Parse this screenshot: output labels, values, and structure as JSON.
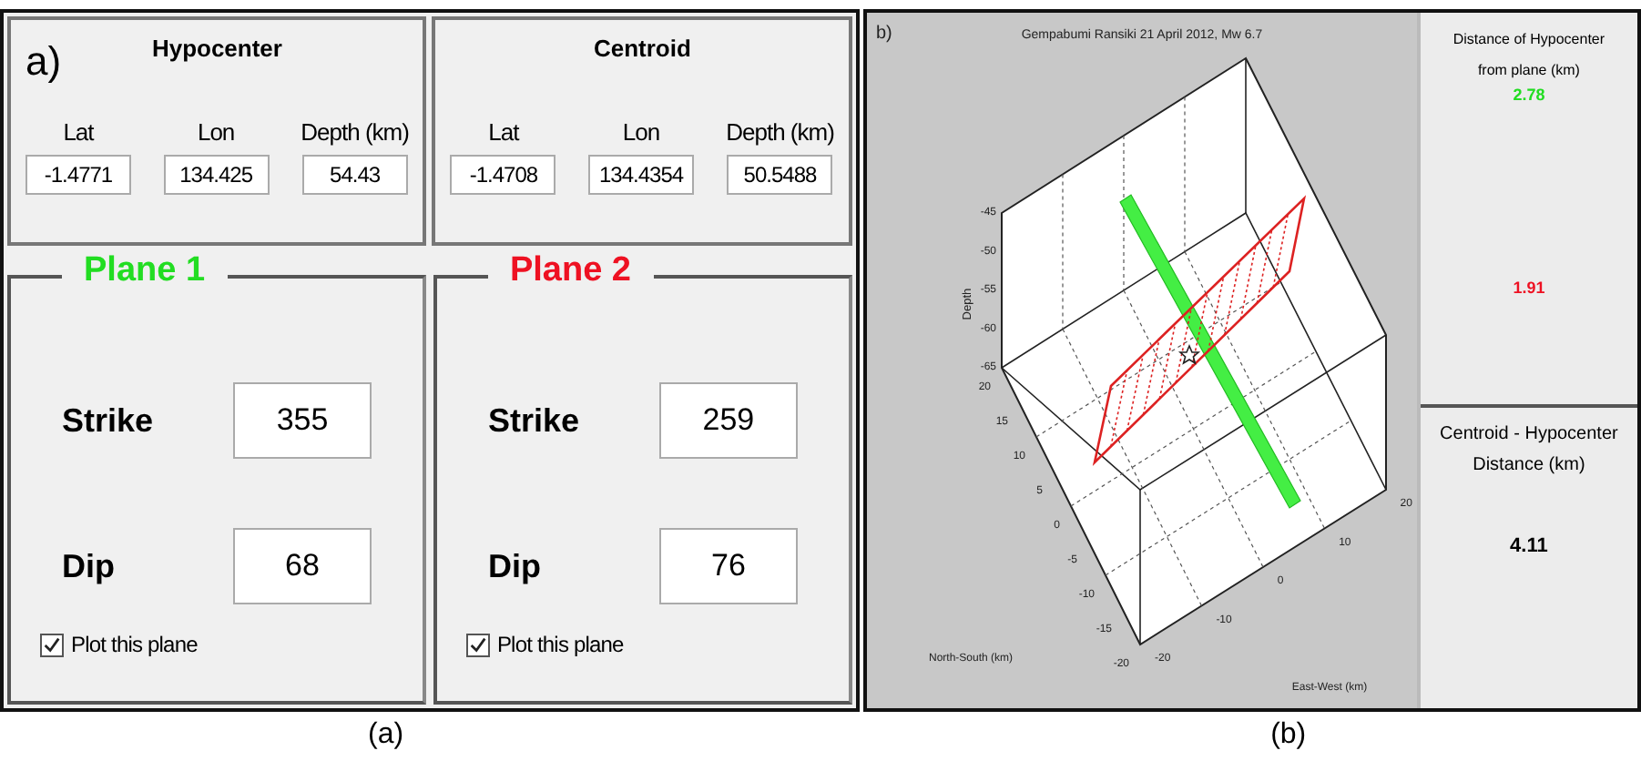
{
  "panel_a": {
    "label": "a)",
    "locations": [
      {
        "title": "Hypocenter",
        "fields": [
          {
            "label": "Lat",
            "value": "-1.4771"
          },
          {
            "label": "Lon",
            "value": "134.425"
          },
          {
            "label": "Depth (km)",
            "value": "54.43"
          }
        ]
      },
      {
        "title": "Centroid",
        "fields": [
          {
            "label": "Lat",
            "value": "-1.4708"
          },
          {
            "label": "Lon",
            "value": "134.4354"
          },
          {
            "label": "Depth (km)",
            "value": "50.5488"
          }
        ]
      }
    ],
    "planes": [
      {
        "title": "Plane 1",
        "color": "#22dd22",
        "strike_label": "Strike",
        "strike": "355",
        "dip_label": "Dip",
        "dip": "68",
        "plot_label": "Plot this plane",
        "checked": true
      },
      {
        "title": "Plane 2",
        "color": "#ee1122",
        "strike_label": "Strike",
        "strike": "259",
        "dip_label": "Dip",
        "dip": "76",
        "plot_label": "Plot this plane",
        "checked": true
      }
    ]
  },
  "panel_b": {
    "label": "b)",
    "plot_title": "Gempabumi Ransiki 21 April 2012, Mw 6.7",
    "depth_label": "Depth",
    "ns_label": "North-South (km)",
    "ew_label": "East-West (km)",
    "depth_ticks": [
      "-45",
      "-50",
      "-55",
      "-60",
      "-65"
    ],
    "ns_ticks": [
      "20",
      "15",
      "10",
      "5",
      "0",
      "-5",
      "-10",
      "-15",
      "-20"
    ],
    "ew_ticks": [
      "-20",
      "-10",
      "0",
      "10",
      "20"
    ],
    "distance_title": "Distance of Hypocenter from plane (km)",
    "distances": [
      {
        "value": "2.78",
        "color": "#22dd22"
      },
      {
        "value": "1.91",
        "color": "#ee1122"
      }
    ],
    "centroid_title": "Centroid - Hypocenter Distance (km)",
    "centroid_distance": "4.11"
  },
  "captions": [
    "(a)",
    "(b)"
  ]
}
